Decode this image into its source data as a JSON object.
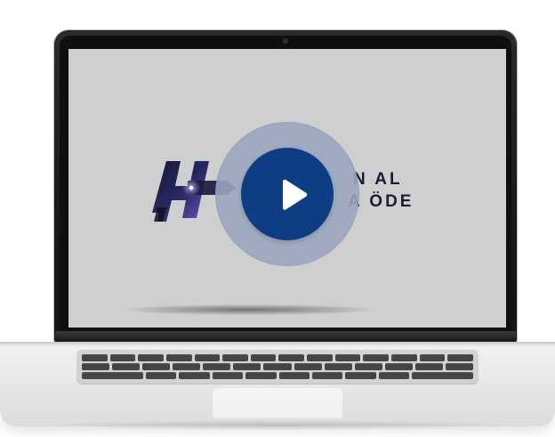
{
  "screen": {
    "background": "#cfcfcf"
  },
  "logo": {
    "line1": "N AL",
    "line2": "A ÖDE",
    "colors": {
      "ink": "#1b1b34",
      "accent": "#6a55c2"
    }
  },
  "video": {
    "play": {
      "icon": "play-icon",
      "colors": {
        "halo": "#9aa6bf",
        "core": "#0e3d84",
        "glyph": "#ffffff"
      }
    }
  }
}
